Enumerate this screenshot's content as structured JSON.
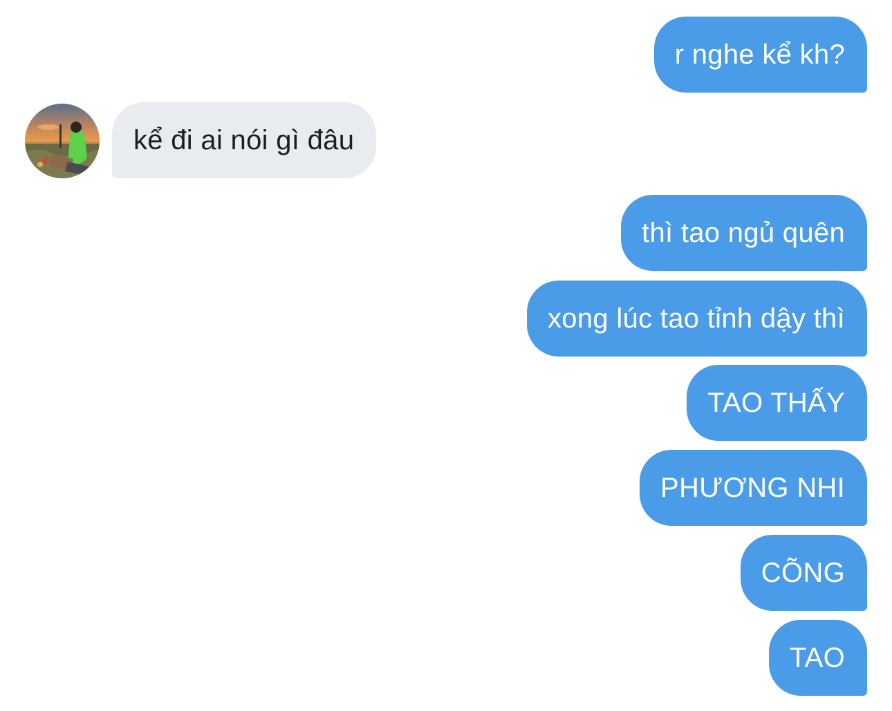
{
  "conversation": {
    "messages": [
      {
        "direction": "outgoing",
        "text": "r nghe kể kh?"
      },
      {
        "direction": "incoming",
        "text": "kể đi ai nói gì đâu",
        "avatar": "contact-avatar-photo"
      },
      {
        "direction": "outgoing",
        "text": "thì tao ngủ quên"
      },
      {
        "direction": "outgoing",
        "text": "xong lúc tao tỉnh dậy thì"
      },
      {
        "direction": "outgoing",
        "text": "TAO THẤY"
      },
      {
        "direction": "outgoing",
        "text": "PHƯƠNG NHI"
      },
      {
        "direction": "outgoing",
        "text": "CÕNG"
      },
      {
        "direction": "outgoing",
        "text": "TAO"
      }
    ]
  },
  "colors": {
    "outgoing_bubble": "#4a9be8",
    "incoming_bubble": "#e8ebef",
    "outgoing_text": "#ffffff",
    "incoming_text": "#1c1e21"
  }
}
